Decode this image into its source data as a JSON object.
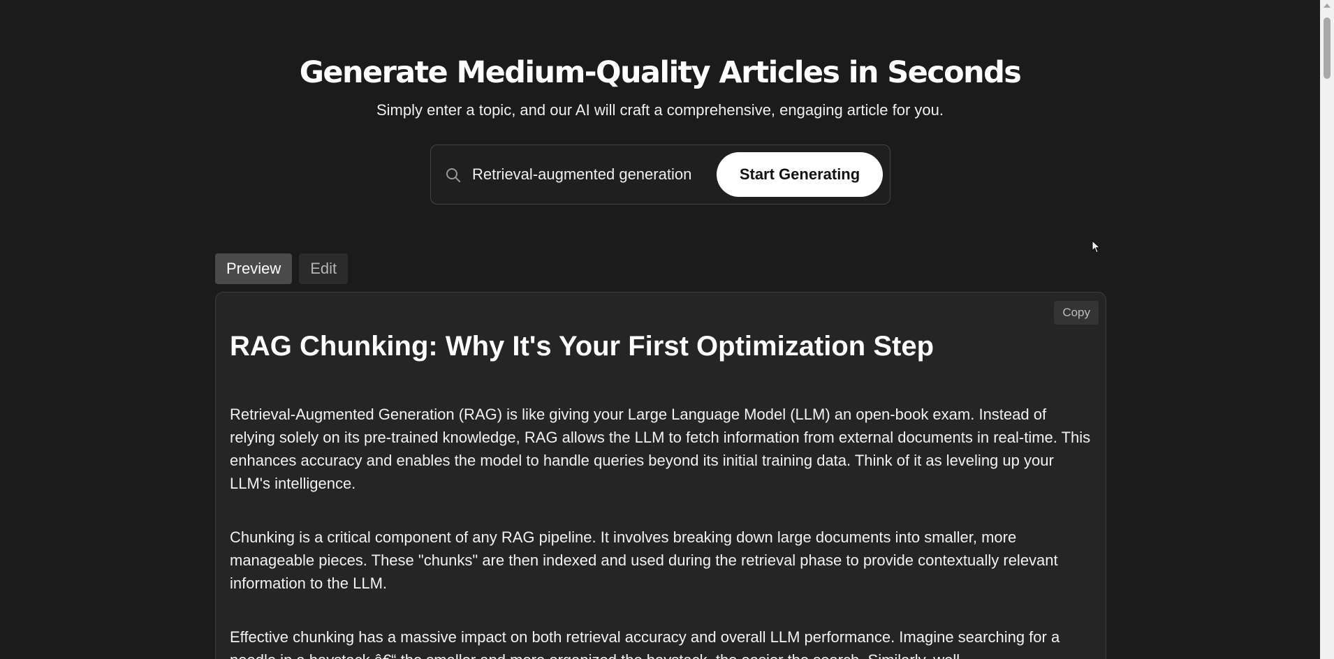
{
  "hero": {
    "title": "Generate Medium-Quality Articles in Seconds",
    "subtitle": "Simply enter a topic, and our AI will craft a comprehensive, engaging article for you."
  },
  "search": {
    "icon": "search-icon",
    "value": "Retrieval-augmented generation",
    "button_label": "Start Generating"
  },
  "tabs": [
    {
      "label": "Preview",
      "active": true
    },
    {
      "label": "Edit",
      "active": false
    }
  ],
  "article": {
    "copy_label": "Copy",
    "title": "RAG Chunking: Why It's Your First Optimization Step",
    "paragraphs": [
      "Retrieval-Augmented Generation (RAG) is like giving your Large Language Model (LLM) an open-book exam. Instead of relying solely on its pre-trained knowledge, RAG allows the LLM to fetch information from external documents in real-time. This enhances accuracy and enables the model to handle queries beyond its initial training data. Think of it as leveling up your LLM's intelligence.",
      "Chunking is a critical component of any RAG pipeline. It involves breaking down large documents into smaller, more manageable pieces. These \"chunks\" are then indexed and used during the retrieval phase to provide contextually relevant information to the LLM.",
      "Effective chunking has a massive impact on both retrieval accuracy and overall LLM performance. Imagine searching for a needle in a haystack â€“ the smaller and more organized the haystack, the easier the search. Similarly, well-"
    ]
  },
  "colors": {
    "background": "#1b1b1b",
    "card": "#252525",
    "accent_button": "#ffffff"
  }
}
